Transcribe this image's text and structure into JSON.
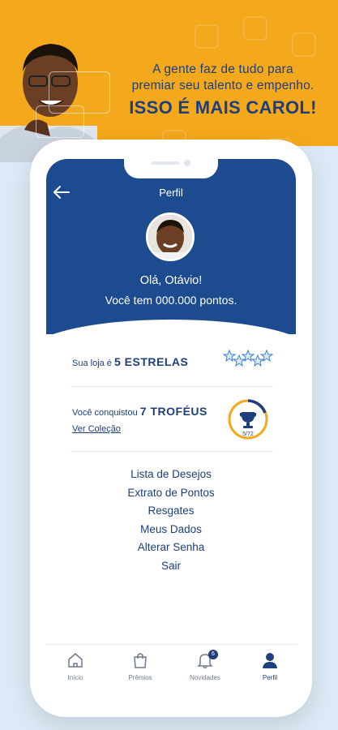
{
  "banner": {
    "line1": "A gente faz de tudo para",
    "line2": "premiar seu talento e empenho.",
    "tagline": "ISSO É MAIS CAROL!"
  },
  "header": {
    "title": "Perfil",
    "greeting": "Olá, Otávio!",
    "points": "Você tem 000.000 pontos."
  },
  "store_rating": {
    "prefix": "Sua loja é",
    "value": "5 ESTRELAS",
    "stars": 5
  },
  "trophies": {
    "prefix": "Você conquistou",
    "value": "7 TROFÉUS",
    "link": "Ver Coleção",
    "progress_text": "5/72",
    "progress_fraction": 0.07
  },
  "menu": [
    {
      "label": "Lista de Desejos"
    },
    {
      "label": "Extrato de Pontos"
    },
    {
      "label": "Resgates"
    },
    {
      "label": "Meus Dados"
    },
    {
      "label": "Alterar Senha"
    },
    {
      "label": "Sair"
    }
  ],
  "tabs": [
    {
      "label": "Início",
      "icon": "home-icon"
    },
    {
      "label": "Prêmios",
      "icon": "shopping-bag-icon"
    },
    {
      "label": "Novidades",
      "icon": "bell-icon",
      "badge": "6"
    },
    {
      "label": "Perfil",
      "icon": "person-icon",
      "active": true
    }
  ],
  "colors": {
    "brand_blue": "#1d4b8f",
    "text_blue": "#1d3f7e",
    "accent_yellow": "#f4a81c",
    "background_blue": "#dbeaf6"
  }
}
